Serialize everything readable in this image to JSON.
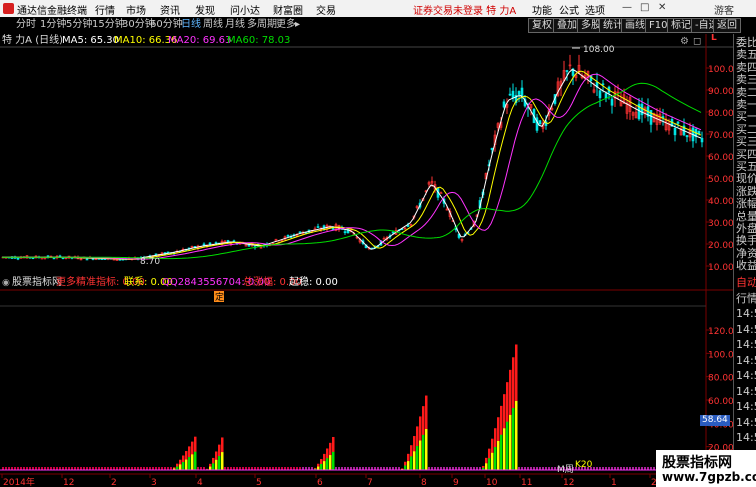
{
  "app": {
    "title": "通达信金融终端"
  },
  "menu": [
    "行情",
    "市场",
    "资讯",
    "发现",
    "问小达",
    "财富圈",
    "交易"
  ],
  "notice": "证券交易未登录  特 力A",
  "right_menu": [
    "功能",
    "公式",
    "选项"
  ],
  "window_buttons": [
    "游客"
  ],
  "periods": [
    "分时",
    "1分钟",
    "5分钟",
    "15分钟",
    "30分钟",
    "60分钟",
    "日线",
    "周线",
    "月线",
    "多周期",
    "更多"
  ],
  "active_period": "日线",
  "right_tools": [
    "复权",
    "叠加",
    "多股",
    "统计",
    "画线",
    "F10",
    "标记",
    "-自选",
    "返回"
  ],
  "main_chart": {
    "stock_title": "特 力A (日线)",
    "ma": [
      {
        "label": "MA5: 65.30",
        "color": "#ffffff"
      },
      {
        "label": "MA10: 66.36",
        "color": "#ffff00"
      },
      {
        "label": "MA20: 69.63",
        "color": "#ff33ff"
      },
      {
        "label": "MA60: 78.03",
        "color": "#00dd00"
      }
    ],
    "high_marker": "108.00",
    "low_marker": "8.70",
    "ding_marker": "定"
  },
  "sub_chart": {
    "title": "股票指标网",
    "items": [
      {
        "label": "更多精准指标: 0.00",
        "color": "#ff3333"
      },
      {
        "label": "联系: 0.00",
        "color": "#ffff00"
      },
      {
        "label": "QQ2843556704: 0.00",
        "color": "#ff33ff"
      },
      {
        "label": "总涨幅: 0.00",
        "color": "#ff3333"
      },
      {
        "label": "起稳: 0.00",
        "color": "#ffffff"
      }
    ],
    "price_tag": "58.64",
    "k_markers": [
      "K20",
      "M周"
    ]
  },
  "price_axis": [
    "100.0",
    "90.00",
    "80.00",
    "70.00",
    "60.00",
    "50.00",
    "40.00",
    "30.00",
    "20.00",
    "10.00"
  ],
  "price_axis_top": "L",
  "sub_axis": [
    "120.0",
    "100.0",
    "80.00",
    "60.00",
    "40.00",
    "20.00"
  ],
  "date_axis": [
    "2014年",
    "12",
    "2",
    "3",
    "4",
    "5",
    "6",
    "7",
    "8",
    "9",
    "10",
    "11",
    "12",
    "1",
    "2"
  ],
  "right_panel": {
    "top": [
      "委比",
      "卖五",
      "卖四",
      "卖三",
      "卖二",
      "卖一",
      "买一",
      "买二",
      "买三",
      "买四",
      "买五",
      "现价",
      "涨跌",
      "涨幅",
      "总量",
      "外盘",
      "换手",
      "净资",
      "收益"
    ],
    "bottom": [
      "自动",
      "行情",
      "14:5",
      "14:5",
      "14:5",
      "14:5",
      "14:5",
      "14:5",
      "14:5",
      "14:5",
      "14:5"
    ]
  },
  "watermark": {
    "line1": "股票指标网",
    "line2": "www.7gpzb.com"
  }
}
